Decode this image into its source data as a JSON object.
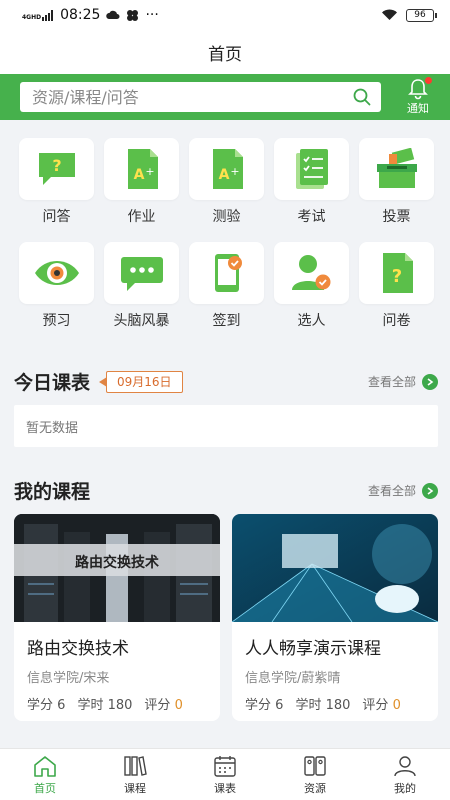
{
  "status": {
    "network": "4GHD",
    "time": "08:25",
    "extra": "···",
    "battery": "96"
  },
  "header": {
    "title": "首页"
  },
  "search": {
    "placeholder": "资源/课程/问答",
    "notify_label": "通知"
  },
  "accent": "#46b14c",
  "features": [
    {
      "label": "问答",
      "icon": "qa-bubble-icon"
    },
    {
      "label": "作业",
      "icon": "homework-icon"
    },
    {
      "label": "测验",
      "icon": "quiz-icon"
    },
    {
      "label": "考试",
      "icon": "exam-icon"
    },
    {
      "label": "投票",
      "icon": "vote-box-icon"
    },
    {
      "label": "预习",
      "icon": "eye-icon"
    },
    {
      "label": "头脑风暴",
      "icon": "chat-dots-icon"
    },
    {
      "label": "签到",
      "icon": "phone-check-icon"
    },
    {
      "label": "选人",
      "icon": "person-pick-icon"
    },
    {
      "label": "问卷",
      "icon": "questionnaire-icon"
    }
  ],
  "today": {
    "title": "今日课表",
    "date": "09月16日",
    "view_all": "查看全部",
    "empty": "暂无数据"
  },
  "courses": {
    "title": "我的课程",
    "view_all": "查看全部",
    "items": [
      {
        "banner": "路由交换技术",
        "name": "路由交换技术",
        "org": "信息学院/宋来",
        "credit_label": "学分",
        "credit": "6",
        "hours_label": "学时",
        "hours": "180",
        "score_label": "评分",
        "score": "0"
      },
      {
        "banner": "",
        "name": "人人畅享演示课程",
        "org": "信息学院/蔚紫晴",
        "credit_label": "学分",
        "credit": "6",
        "hours_label": "学时",
        "hours": "180",
        "score_label": "评分",
        "score": "0"
      }
    ]
  },
  "tabs": [
    {
      "label": "首页",
      "icon": "home-icon",
      "active": true
    },
    {
      "label": "课程",
      "icon": "books-icon",
      "active": false
    },
    {
      "label": "课表",
      "icon": "calendar-icon",
      "active": false
    },
    {
      "label": "资源",
      "icon": "resource-icon",
      "active": false
    },
    {
      "label": "我的",
      "icon": "user-icon",
      "active": false
    }
  ]
}
